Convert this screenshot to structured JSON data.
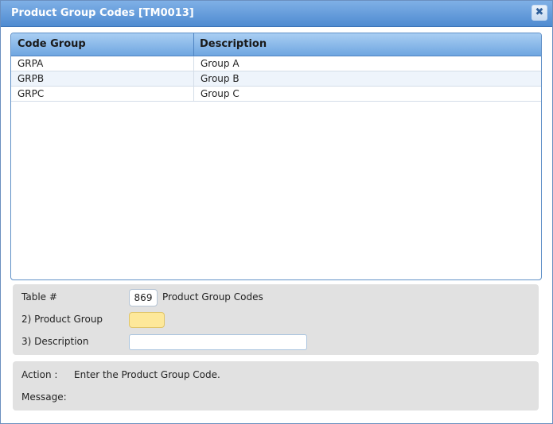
{
  "window": {
    "title": "Product Group Codes [TM0013]",
    "close_symbol": "✖"
  },
  "grid": {
    "columns": [
      "Code Group",
      "Description"
    ],
    "rows": [
      {
        "code": "GRPA",
        "description": "Group A"
      },
      {
        "code": "GRPB",
        "description": "Group B"
      },
      {
        "code": "GRPC",
        "description": "Group C"
      }
    ]
  },
  "form": {
    "table_label": "Table #",
    "table_value": "869",
    "table_name": "Product Group Codes",
    "product_group_label": "2) Product Group",
    "product_group_value": "",
    "description_label": "3) Description",
    "description_value": ""
  },
  "status": {
    "action_label": "Action :",
    "action_text": "Enter the Product Group Code.",
    "message_label": "Message:",
    "message_text": ""
  },
  "colors": {
    "title_bar": "#4f8bd1",
    "grid_header": "#6fa6e0",
    "required_field": "#fde89a",
    "panel_bg": "#e1e1e1"
  }
}
